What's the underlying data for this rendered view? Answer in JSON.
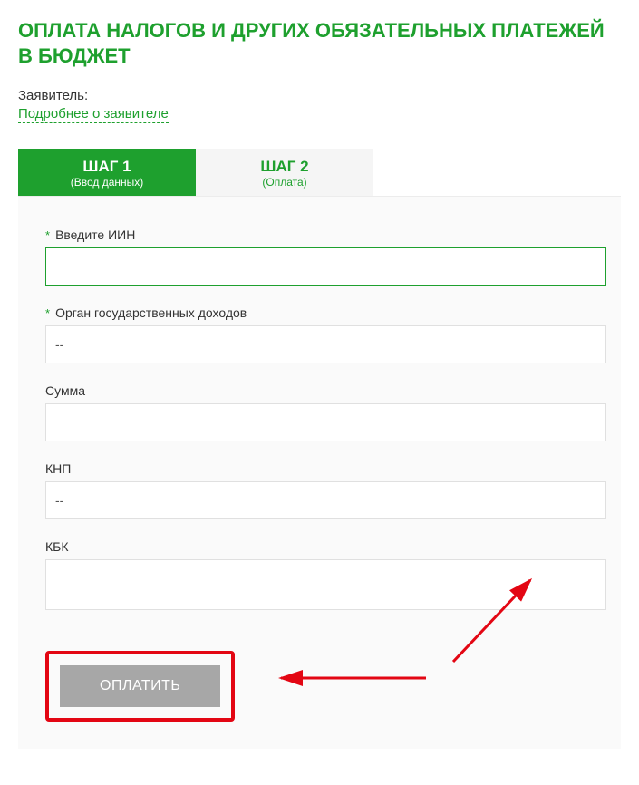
{
  "title": "ОПЛАТА НАЛОГОВ И ДРУГИХ ОБЯЗАТЕЛЬНЫХ ПЛАТЕЖЕЙ В БЮДЖЕТ",
  "applicant": {
    "label": "Заявитель:",
    "more_link": "Подробнее о заявителе"
  },
  "tabs": {
    "step1": {
      "title": "ШАГ 1",
      "sub": "(Ввод данных)"
    },
    "step2": {
      "title": "ШАГ 2",
      "sub": "(Оплата)"
    }
  },
  "form": {
    "iin": {
      "label": "Введите ИИН",
      "value": ""
    },
    "agency": {
      "label": "Орган государственных доходов",
      "value": "--"
    },
    "sum": {
      "label": "Сумма",
      "value": ""
    },
    "knp": {
      "label": "КНП",
      "value": "--"
    },
    "kbk": {
      "label": "КБК",
      "value": ""
    }
  },
  "buttons": {
    "pay": "ОПЛАТИТЬ"
  }
}
